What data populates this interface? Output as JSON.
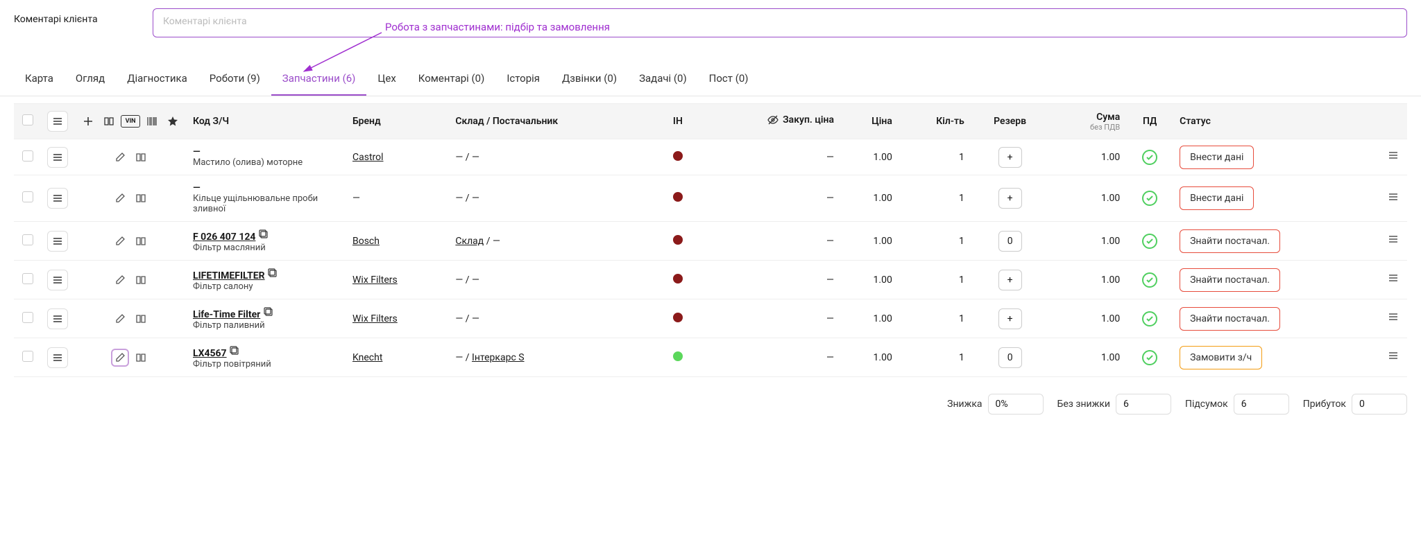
{
  "client_comments": {
    "label": "Коментарі клієнта",
    "placeholder": "Коментарі клієнта"
  },
  "annotation": "Робота з запчастинами: підбір та замовлення",
  "tabs": [
    {
      "label": "Карта",
      "active": false
    },
    {
      "label": "Огляд",
      "active": false
    },
    {
      "label": "Діагностика",
      "active": false
    },
    {
      "label": "Роботи (9)",
      "active": false
    },
    {
      "label": "Запчастини (6)",
      "active": true
    },
    {
      "label": "Цех",
      "active": false
    },
    {
      "label": "Коментарі (0)",
      "active": false
    },
    {
      "label": "Історія",
      "active": false
    },
    {
      "label": "Дзвінки (0)",
      "active": false
    },
    {
      "label": "Задачі (0)",
      "active": false
    },
    {
      "label": "Пост (0)",
      "active": false
    }
  ],
  "columns": {
    "code": "Код З/Ч",
    "brand": "Бренд",
    "supplier": "Склад / Постачальник",
    "in": "ІН",
    "purchase": "Закуп. ціна",
    "price": "Ціна",
    "qty": "Кіл-ть",
    "reserve": "Резерв",
    "sum": "Сума",
    "sum_sub": "без ПДВ",
    "pd": "ПД",
    "status": "Статус"
  },
  "rows": [
    {
      "code": "—",
      "desc": "Мастило (олива) моторне",
      "brand": "Castrol",
      "supplier": "— / —",
      "dot": "red",
      "purchase": "—",
      "price": "1.00",
      "qty": "1",
      "reserve": "+",
      "sum": "1.00",
      "status_label": "Внести дані",
      "status_color": "red",
      "edit_highlight": false
    },
    {
      "code": "—",
      "desc": "Кільце ущільнювальне проби зливної",
      "brand": "—",
      "supplier": "— / —",
      "dot": "red",
      "purchase": "—",
      "price": "1.00",
      "qty": "1",
      "reserve": "+",
      "sum": "1.00",
      "status_label": "Внести дані",
      "status_color": "red",
      "edit_highlight": false
    },
    {
      "code": "F 026 407 124",
      "desc": "Фільтр масляний",
      "brand": "Bosch",
      "supplier_pre": "Склад",
      "supplier_post": " / —",
      "dot": "red",
      "purchase": "—",
      "price": "1.00",
      "qty": "1",
      "reserve": "0",
      "sum": "1.00",
      "status_label": "Знайти постачал.",
      "status_color": "red",
      "edit_highlight": false
    },
    {
      "code": "LIFETIMEFILTER",
      "desc": "Фільтр салону",
      "brand": "Wix Filters",
      "supplier": "— / —",
      "dot": "red",
      "purchase": "—",
      "price": "1.00",
      "qty": "1",
      "reserve": "+",
      "sum": "1.00",
      "status_label": "Знайти постачал.",
      "status_color": "red",
      "edit_highlight": false
    },
    {
      "code": "Life-Time Filter",
      "desc": "Фільтр паливний",
      "brand": "Wix Filters",
      "supplier": "— / —",
      "dot": "red",
      "purchase": "—",
      "price": "1.00",
      "qty": "1",
      "reserve": "+",
      "sum": "1.00",
      "status_label": "Знайти постачал.",
      "status_color": "red",
      "edit_highlight": false
    },
    {
      "code": "LX4567",
      "desc": "Фільтр повітряний",
      "brand": "Knecht",
      "supplier_pre": "— / ",
      "supplier_link": "Інтеркарс S",
      "dot": "green",
      "purchase": "—",
      "price": "1.00",
      "qty": "1",
      "reserve": "0",
      "sum": "1.00",
      "status_label": "Замовити з/ч",
      "status_color": "orange",
      "edit_highlight": true
    }
  ],
  "summary": {
    "discount_label": "Знижка",
    "discount_value": "0%",
    "no_discount_label": "Без знижки",
    "no_discount_value": "6",
    "subtotal_label": "Підсумок",
    "subtotal_value": "6",
    "profit_label": "Прибуток",
    "profit_value": "0"
  }
}
